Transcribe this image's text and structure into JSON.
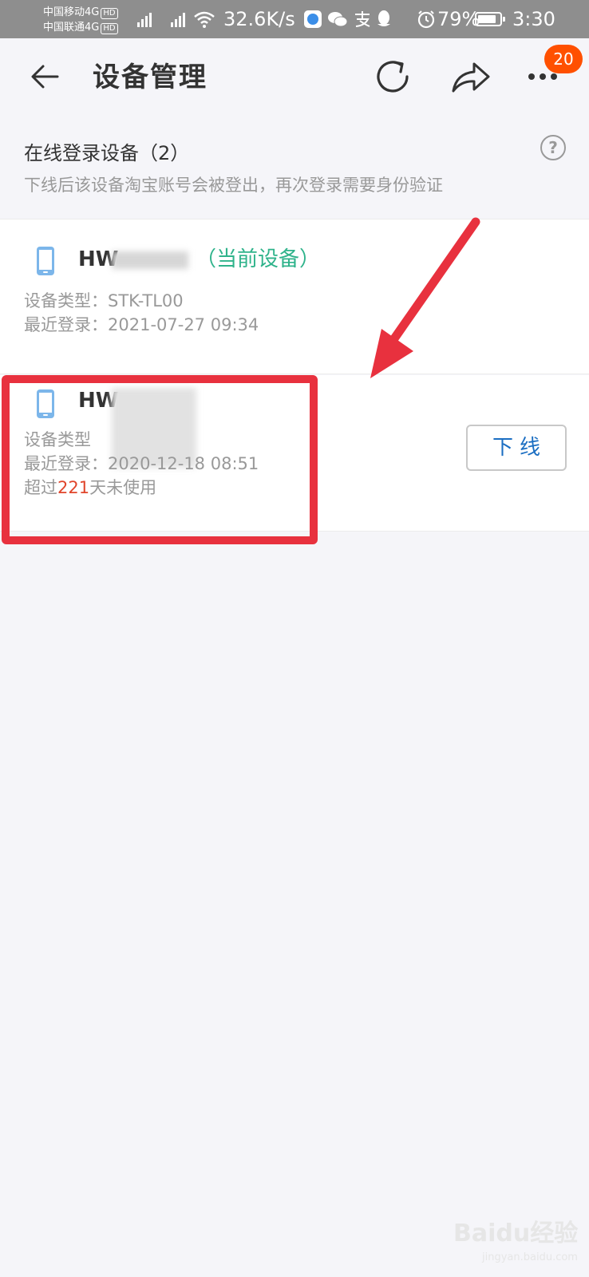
{
  "status_bar": {
    "carrier_1": "中国移动4G",
    "carrier_2": "中国联通4G",
    "hd_label": "HD",
    "net_speed": "32.6K/s",
    "battery": "79%",
    "time": "3:30"
  },
  "header": {
    "title": "设备管理",
    "badge_count": "20"
  },
  "section": {
    "title": "在线登录设备（2）",
    "description": "下线后该设备淘宝账号会被登出，再次登录需要身份验证",
    "help_label": "?"
  },
  "devices": [
    {
      "name": "HW",
      "current_tag": "（当前设备）",
      "type_line": "设备类型：STK-TL00",
      "login_line": "最近登录：2021-07-27 09:34"
    },
    {
      "name": "HW",
      "type_line": "设备类型",
      "login_line": "最近登录：2020-12-18 08:51",
      "unused_prefix": "超过",
      "unused_days": "221",
      "unused_suffix": "天未使用",
      "offline_button": "下线"
    }
  ],
  "watermark": {
    "text": "Baidu经验",
    "sub": "jingyan.baidu.com"
  },
  "colors": {
    "accent": "#ff5000",
    "current_tag": "#2fb38b",
    "warning": "#e0452b",
    "link": "#1b6ec2",
    "annotation": "#e8313e"
  }
}
